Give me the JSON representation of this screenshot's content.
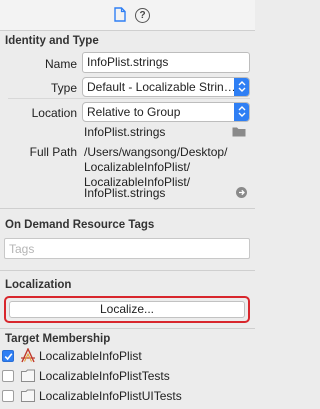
{
  "tabs": {
    "file_icon": "file-inspector-icon",
    "help_icon": "quick-help-icon",
    "help_glyph": "?"
  },
  "identity": {
    "header": "Identity and Type",
    "name_label": "Name",
    "name_value": "InfoPlist.strings",
    "type_label": "Type",
    "type_value": "Default - Localizable Strin…",
    "location_label": "Location",
    "location_value": "Relative to Group",
    "location_filename": "InfoPlist.strings",
    "full_path_label": "Full Path",
    "full_path_lines": [
      "/Users/wangsong/Desktop/",
      "LocalizableInfoPlist/",
      "LocalizableInfoPlist/",
      "InfoPlist.strings"
    ]
  },
  "on_demand": {
    "header": "On Demand Resource Tags",
    "tags_placeholder": "Tags"
  },
  "localization": {
    "header": "Localization",
    "button_label": "Localize..."
  },
  "target_membership": {
    "header": "Target Membership",
    "targets": [
      {
        "label": "LocalizableInfoPlist",
        "checked": true,
        "icon": "app-target-icon"
      },
      {
        "label": "LocalizableInfoPlistTests",
        "checked": false,
        "icon": "test-bundle-icon"
      },
      {
        "label": "LocalizableInfoPlistUITests",
        "checked": false,
        "icon": "test-bundle-icon"
      }
    ]
  },
  "colors": {
    "accent": "#2f7ff4",
    "highlight_border": "#d8262c"
  }
}
